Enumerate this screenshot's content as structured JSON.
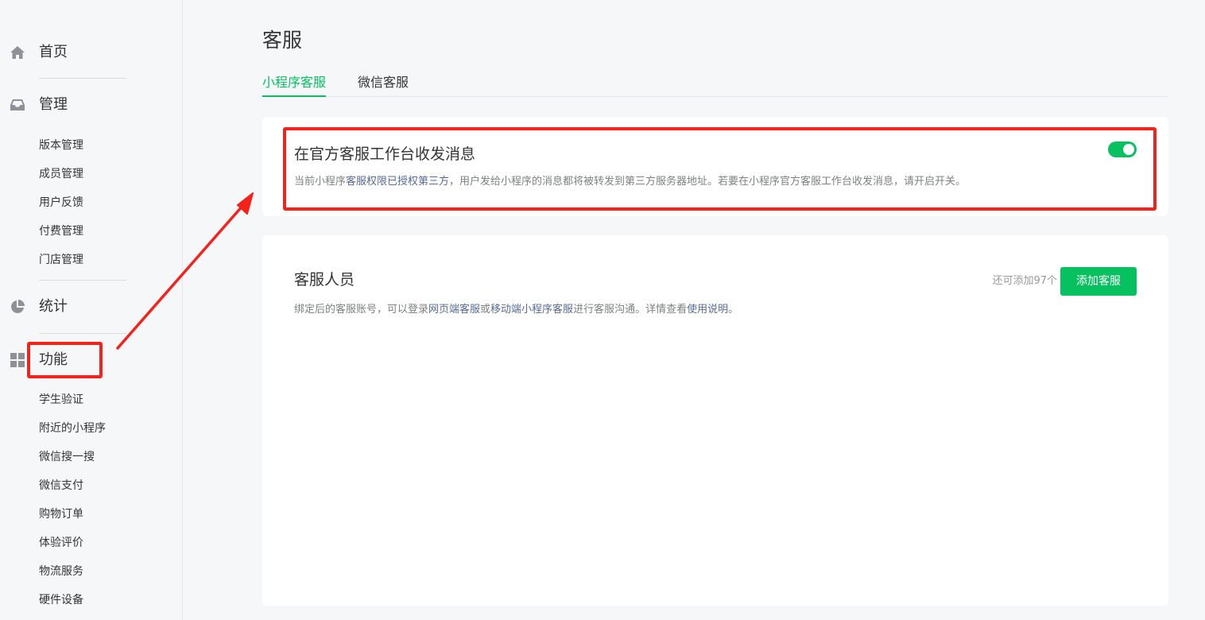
{
  "sidebar": {
    "sections": [
      {
        "label": "首页",
        "icon": "home-icon"
      },
      {
        "label": "管理",
        "icon": "inbox-icon",
        "items": [
          "版本管理",
          "成员管理",
          "用户反馈",
          "付费管理",
          "门店管理"
        ]
      },
      {
        "label": "统计",
        "icon": "pie-chart-icon"
      },
      {
        "label": "功能",
        "icon": "grid-icon",
        "items": [
          "学生验证",
          "附近的小程序",
          "微信搜一搜",
          "微信支付",
          "购物订单",
          "体验评价",
          "物流服务",
          "硬件设备"
        ]
      }
    ]
  },
  "main": {
    "title": "客服",
    "tabs": [
      {
        "label": "小程序客服",
        "active": true
      },
      {
        "label": "微信客服",
        "active": false
      }
    ],
    "official_workbench": {
      "title": "在官方客服工作台收发消息",
      "desc_prefix": "当前小程序",
      "desc_link": "客服权限已授权第三方",
      "desc_suffix": "，用户发给小程序的消息都将被转发到第三方服务器地址。若要在小程序官方客服工作台收发消息，请开启开关。",
      "toggle_on": true
    },
    "staff": {
      "title": "客服人员",
      "remaining": "还可添加97个",
      "add_button": "添加客服",
      "desc_part1": "绑定后的客服账号，可以登录",
      "desc_link1": "网页端客服",
      "desc_part2": "或",
      "desc_link2": "移动端小程序客服",
      "desc_part3": "进行客服沟通。详情查看",
      "desc_link3": "使用说明",
      "desc_part4": "。"
    }
  },
  "colors": {
    "accent": "#07c160",
    "link": "#576b95",
    "annotation": "#f5221b"
  }
}
